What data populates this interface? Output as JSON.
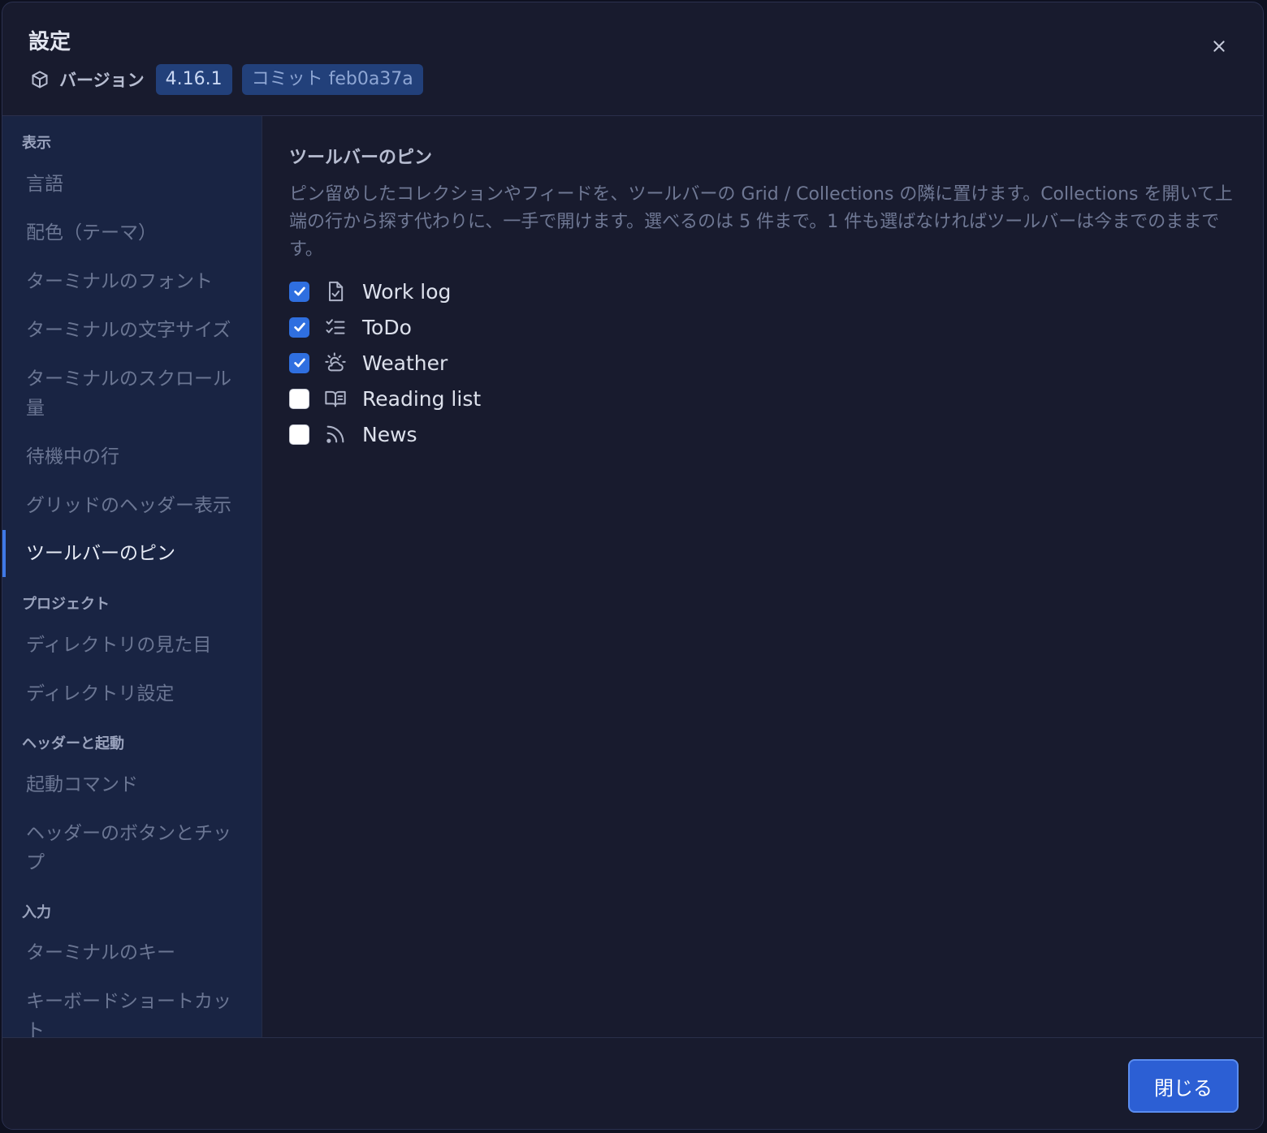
{
  "dialog": {
    "title": "設定",
    "version_label": "バージョン",
    "version": "4.16.1",
    "commit": "コミット feb0a37a",
    "close_icon": "close-icon"
  },
  "sidebar": {
    "sections": [
      {
        "label": "表示",
        "items": [
          "言語",
          "配色（テーマ）",
          "ターミナルのフォント",
          "ターミナルの文字サイズ",
          "ターミナルのスクロール量",
          "待機中の行",
          "グリッドのヘッダー表示",
          "ツールバーのピン"
        ]
      },
      {
        "label": "プロジェクト",
        "items": [
          "ディレクトリの見た目",
          "ディレクトリ設定"
        ]
      },
      {
        "label": "ヘッダーと起動",
        "items": [
          "起動コマンド",
          "ヘッダーのボタンとチップ"
        ]
      },
      {
        "label": "入力",
        "items": [
          "ターミナルのキー",
          "キーボードショートカット"
        ]
      }
    ],
    "active_item": "ツールバーのピン",
    "accent_color": "#3f79e6"
  },
  "content": {
    "title": "ツールバーのピン",
    "description": "ピン留めしたコレクションやフィードを、ツールバーの Grid / Collections の隣に置けます。Collections を開いて上端の行から探す代わりに、一手で開けます。選べるのは 5 件まで。1 件も選ばなければツールバーは今までのままです。",
    "options": [
      {
        "label": "Work log",
        "checked": true,
        "icon": "file-check-icon"
      },
      {
        "label": "ToDo",
        "checked": true,
        "icon": "list-todo-icon"
      },
      {
        "label": "Weather",
        "checked": true,
        "icon": "cloud-sun-icon"
      },
      {
        "label": "Reading list",
        "checked": false,
        "icon": "book-open-icon"
      },
      {
        "label": "News",
        "checked": false,
        "icon": "rss-icon"
      }
    ]
  },
  "footer": {
    "close_label": "閉じる"
  }
}
